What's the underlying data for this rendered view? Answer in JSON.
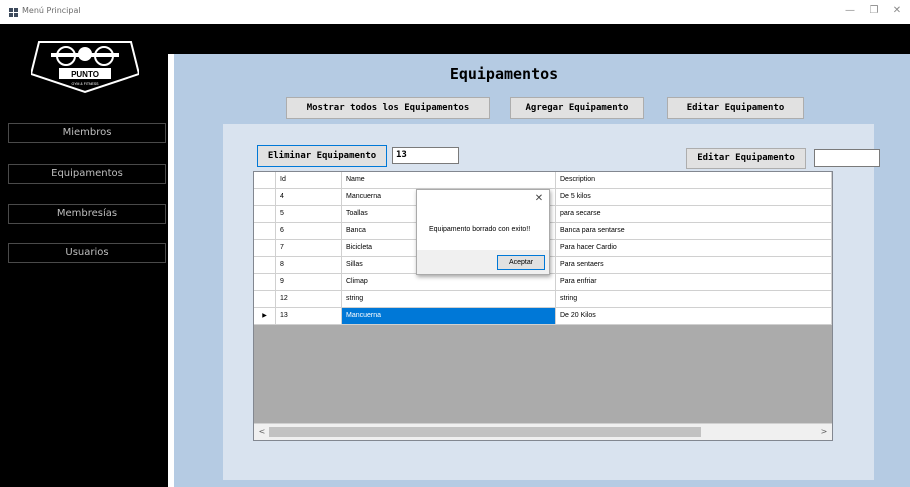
{
  "window": {
    "title": "Menú Principal",
    "controls": {
      "minimize": "—",
      "maximize": "❐",
      "close": "✕"
    }
  },
  "sidebar": {
    "logo_text": "PUNTO",
    "logo_subtext": "GYM & FITNESS",
    "items": [
      {
        "label": "Miembros"
      },
      {
        "label": "Equipamentos"
      },
      {
        "label": "Membresías"
      },
      {
        "label": "Usuarios"
      }
    ]
  },
  "main": {
    "title": "Equipamentos",
    "buttons": {
      "show_all": "Mostrar todos los Equipamentos",
      "add": "Agregar Equipamento",
      "edit": "Editar Equipamento"
    },
    "delete_button": "Eliminar Equipamento",
    "delete_id_value": "13",
    "edit_button": "Editar Equipamento",
    "edit_value": ""
  },
  "grid": {
    "columns": [
      "Id",
      "Name",
      "Description"
    ],
    "rows": [
      {
        "id": "4",
        "name": "Mancuerna",
        "description": "De 5 kilos"
      },
      {
        "id": "5",
        "name": "Toallas",
        "description": "para secarse"
      },
      {
        "id": "6",
        "name": "Banca",
        "description": "Banca para sentarse"
      },
      {
        "id": "7",
        "name": "Bicicleta",
        "description": "Para hacer Cardio"
      },
      {
        "id": "8",
        "name": "Sillas",
        "description": "Para sentaers"
      },
      {
        "id": "9",
        "name": "Climap",
        "description": "Para enfriar"
      },
      {
        "id": "12",
        "name": "string",
        "description": "string"
      },
      {
        "id": "13",
        "name": "Mancuerna",
        "description": "De 20 Kilos"
      }
    ],
    "current_row_marker": "▶",
    "scroll_left": "<",
    "scroll_right": ">"
  },
  "dialog": {
    "message": "Equipamento borrado con exito!!",
    "ok_label": "Aceptar",
    "close_glyph": "✕"
  },
  "colors": {
    "sidebar": "#000000",
    "panel": "#b5cbe3",
    "inner_panel": "#d9e3ef",
    "selection": "#0078d7"
  }
}
